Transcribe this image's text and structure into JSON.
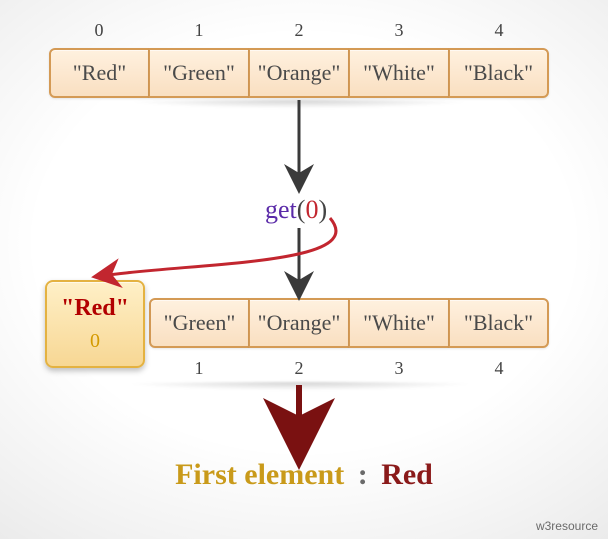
{
  "chart_data": {
    "type": "table",
    "title": "Linked list get(index) illustration",
    "top_list": {
      "indices": [
        0,
        1,
        2,
        3,
        4
      ],
      "values": [
        "\"Red\"",
        "\"Green\"",
        "\"Orange\"",
        "\"White\"",
        "\"Black\""
      ]
    },
    "operation": {
      "method": "get",
      "arg": 0,
      "display": "get(0)"
    },
    "bottom_list": {
      "indices": [
        0,
        1,
        2,
        3,
        4
      ],
      "values": [
        "\"Red\"",
        "\"Green\"",
        "\"Orange\"",
        "\"White\"",
        "\"Black\""
      ],
      "highlighted_index": 0
    },
    "result": {
      "label": "First element",
      "separator": ":",
      "value": "Red"
    }
  },
  "colors": {
    "cell_border": "#d49a55",
    "cell_fill_top": "#fff1df",
    "cell_fill_bottom": "#f9dfc1",
    "highlight_border": "#e4b241",
    "highlight_fill_top": "#fff0c7",
    "highlight_fill_bottom": "#f7d794",
    "method_fn": "#5a2aa8",
    "method_arg": "#c2262f",
    "result_label": "#c99a1a",
    "result_value": "#8a1a1a",
    "arrow_black": "#3a3a3a",
    "arrow_red": "#c2262f",
    "arrow_maroon": "#7a1111"
  },
  "watermark": "w3resource"
}
